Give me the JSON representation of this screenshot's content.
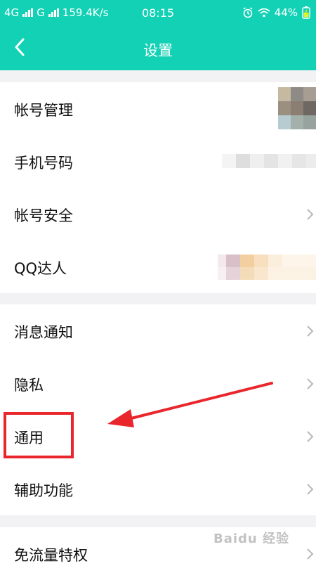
{
  "status": {
    "network1": "4G",
    "network2": "G",
    "speed": "159.4K/s",
    "time": "08:15",
    "battery": "44%"
  },
  "header": {
    "title": "设置"
  },
  "groups": [
    {
      "items": [
        {
          "label": "帐号管理"
        },
        {
          "label": "手机号码"
        },
        {
          "label": "帐号安全"
        },
        {
          "label": "QQ达人"
        }
      ]
    },
    {
      "items": [
        {
          "label": "消息通知"
        },
        {
          "label": "隐私"
        },
        {
          "label": "通用"
        },
        {
          "label": "辅助功能"
        }
      ]
    },
    {
      "items": [
        {
          "label": "免流量特权"
        }
      ]
    }
  ],
  "watermark": "Baidu 经验",
  "colors": {
    "accent": "#13d1b5",
    "annotation": "#e8262c"
  },
  "icons": [
    "back-icon",
    "chevron-right-icon",
    "alarm-icon",
    "wifi-icon",
    "battery-icon",
    "signal-icon"
  ]
}
